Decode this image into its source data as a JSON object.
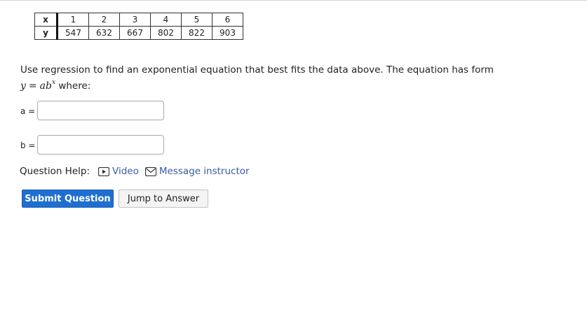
{
  "table": {
    "row_x": {
      "label": "x",
      "values": [
        "1",
        "2",
        "3",
        "4",
        "5",
        "6"
      ]
    },
    "row_y": {
      "label": "y",
      "values": [
        "547",
        "632",
        "667",
        "802",
        "822",
        "903"
      ]
    }
  },
  "prompt": {
    "line1": "Use regression to find an exponential equation that best fits the data above. The equation has form",
    "eq_y": "y",
    "eq_equals": "=",
    "eq_ab": "ab",
    "eq_exp": "x",
    "line2_suffix": " where:"
  },
  "inputs": {
    "a_label": "a =",
    "a_value": "",
    "b_label": "b =",
    "b_value": ""
  },
  "help": {
    "label": "Question Help:",
    "video_label": "Video",
    "message_label": "Message instructor",
    "video_icon": "play-icon",
    "message_icon": "envelope-icon"
  },
  "buttons": {
    "submit_label": "Submit Question",
    "jump_label": "Jump to Answer"
  }
}
